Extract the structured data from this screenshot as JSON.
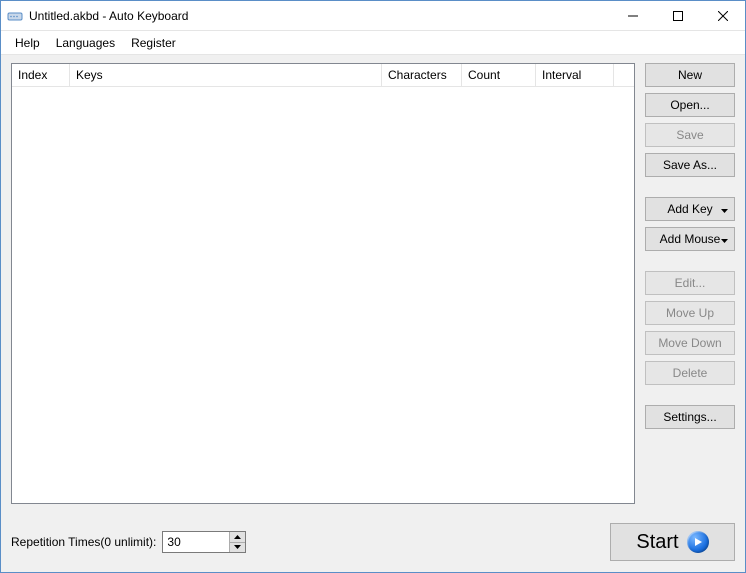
{
  "title": "Untitled.akbd - Auto Keyboard",
  "menubar": {
    "help": "Help",
    "languages": "Languages",
    "register": "Register"
  },
  "columns": {
    "index": "Index",
    "keys": "Keys",
    "characters": "Characters",
    "count": "Count",
    "interval": "Interval"
  },
  "buttons": {
    "new": "New",
    "open": "Open...",
    "save": "Save",
    "save_as": "Save As...",
    "add_key": "Add Key",
    "add_mouse": "Add Mouse",
    "edit": "Edit...",
    "move_up": "Move Up",
    "move_down": "Move Down",
    "delete": "Delete",
    "settings": "Settings..."
  },
  "bottom": {
    "rep_label": "Repetition Times(0 unlimit):",
    "rep_value": "30",
    "start": "Start"
  }
}
